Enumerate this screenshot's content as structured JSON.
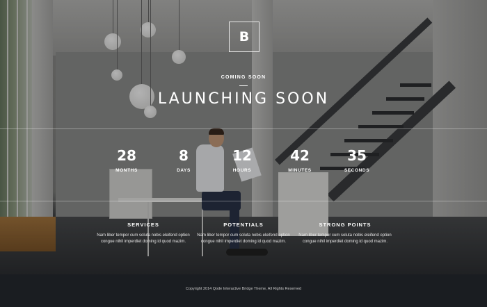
{
  "brand": {
    "logo_letter": "B"
  },
  "hero": {
    "eyebrow": "COMING SOON",
    "title": "LAUNCHING SOON"
  },
  "countdown": [
    {
      "value": "28",
      "label": "MONTHS"
    },
    {
      "value": "8",
      "label": "DAYS"
    },
    {
      "value": "12",
      "label": "HOURS"
    },
    {
      "value": "42",
      "label": "MINUTES"
    },
    {
      "value": "35",
      "label": "SECONDS"
    }
  ],
  "features": [
    {
      "title": "SERVICES",
      "text_line1": "Nam liber tempor cum soluta nobis eleifend option",
      "text_line2": "congue nihil imperdiet doming id quod mazim."
    },
    {
      "title": "POTENTIALS",
      "text_line1": "Nam liber tempor cum soluta nobis eleifend option",
      "text_line2": "congue nihil imperdiet doming id quod mazim."
    },
    {
      "title": "STRONG POINTS",
      "text_line1": "Nam liber tempor cum soluta nobis eleifend option",
      "text_line2": "congue nihil imperdiet doming id quod mazim."
    }
  ],
  "footer": {
    "copyright": "Copyright 2014 Qode Interactive Bridge Theme, All Rights Reserved"
  },
  "colors": {
    "overlay": "rgba(0,0,0,0.30)",
    "footer_bg": "#1a1d21",
    "text": "#ffffff"
  }
}
